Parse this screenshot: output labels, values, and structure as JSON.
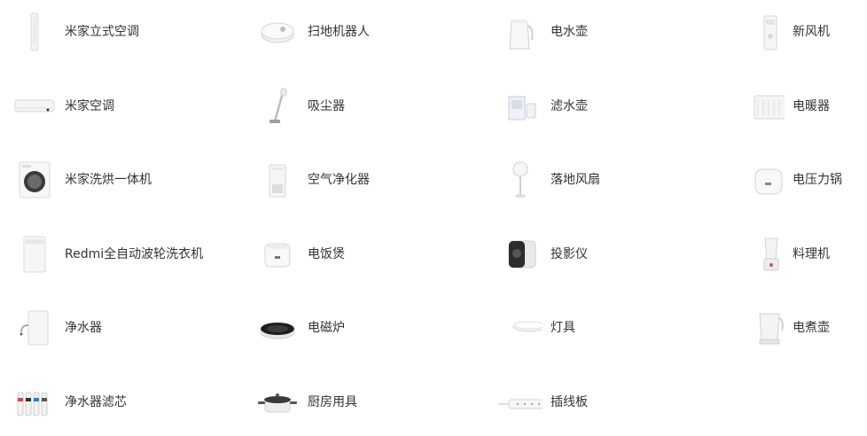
{
  "products": {
    "columns": [
      [
        {
          "label": "米家立式空调",
          "icon": "standing-ac-icon"
        },
        {
          "label": "米家空调",
          "icon": "wall-ac-icon"
        },
        {
          "label": "米家洗烘一体机",
          "icon": "washer-dryer-icon"
        },
        {
          "label": "Redmi全自动波轮洗衣机",
          "icon": "top-load-washer-icon"
        },
        {
          "label": "净水器",
          "icon": "water-purifier-icon"
        },
        {
          "label": "净水器滤芯",
          "icon": "filter-cartridge-icon"
        }
      ],
      [
        {
          "label": "扫地机器人",
          "icon": "robot-vacuum-icon"
        },
        {
          "label": "吸尘器",
          "icon": "stick-vacuum-icon"
        },
        {
          "label": "空气净化器",
          "icon": "air-purifier-icon"
        },
        {
          "label": "电饭煲",
          "icon": "rice-cooker-icon"
        },
        {
          "label": "电磁炉",
          "icon": "induction-cooker-icon"
        },
        {
          "label": "厨房用具",
          "icon": "pot-icon"
        }
      ],
      [
        {
          "label": "电水壶",
          "icon": "kettle-icon"
        },
        {
          "label": "滤水壶",
          "icon": "filter-pitcher-icon"
        },
        {
          "label": "落地风扇",
          "icon": "floor-fan-icon"
        },
        {
          "label": "投影仪",
          "icon": "projector-icon"
        },
        {
          "label": "灯具",
          "icon": "ceiling-lamp-icon"
        },
        {
          "label": "插线板",
          "icon": "power-strip-icon"
        }
      ],
      [
        {
          "label": "新风机",
          "icon": "fresh-air-icon"
        },
        {
          "label": "电暖器",
          "icon": "heater-icon"
        },
        {
          "label": "电压力锅",
          "icon": "pressure-cooker-icon"
        },
        {
          "label": "料理机",
          "icon": "blender-icon"
        },
        {
          "label": "电煮壶",
          "icon": "health-pot-icon"
        }
      ]
    ]
  }
}
